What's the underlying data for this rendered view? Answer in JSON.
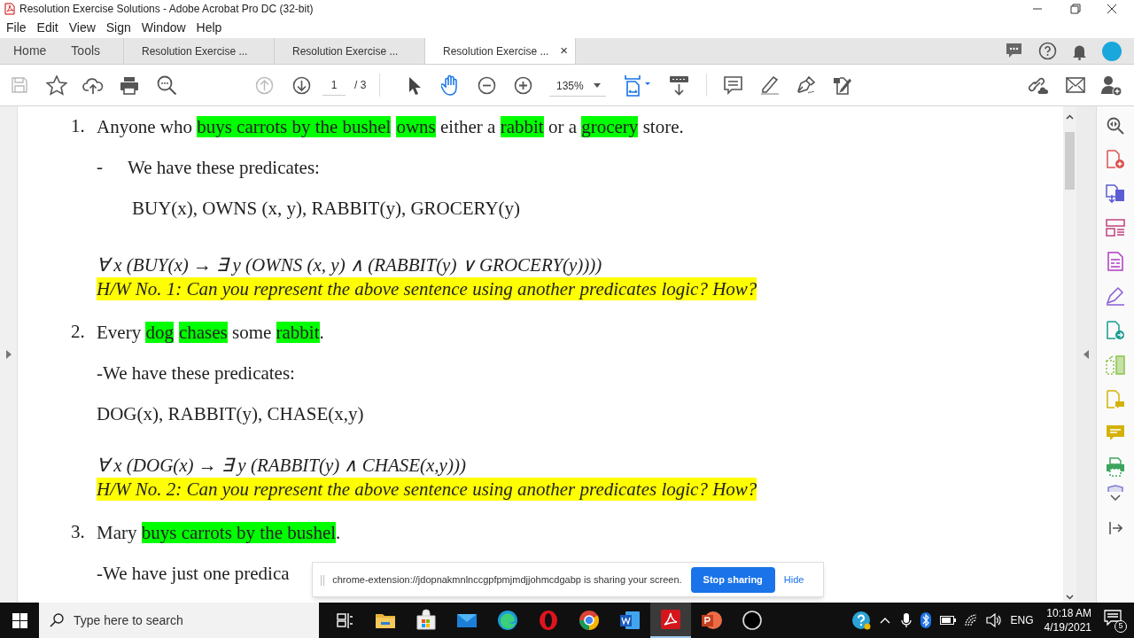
{
  "window": {
    "title": "Resolution Exercise Solutions - Adobe Acrobat Pro DC (32-bit)"
  },
  "menu": [
    "File",
    "Edit",
    "View",
    "Sign",
    "Window",
    "Help"
  ],
  "nav": [
    "Home",
    "Tools"
  ],
  "tabs": [
    {
      "label": "Resolution Exercise ...",
      "selected": false
    },
    {
      "label": "Resolution Exercise ...",
      "selected": false
    },
    {
      "label": "Resolution Exercise ...",
      "selected": true,
      "close": "×"
    }
  ],
  "toolbar": {
    "page": "1",
    "page_total": "/ 3",
    "zoom": "135%"
  },
  "document": [
    {
      "kind": "numbered",
      "number": "1.",
      "segments": [
        {
          "text": "Anyone who ",
          "highlight": false
        },
        {
          "text": "buys carrots by the bushel",
          "highlight": true,
          "space_after": true
        },
        {
          "text": "owns",
          "highlight": true
        },
        {
          "text": " either a ",
          "highlight": false
        },
        {
          "text": "rabbit",
          "highlight": true
        },
        {
          "text": " or a ",
          "highlight": false
        },
        {
          "text": "grocery",
          "highlight": true
        },
        {
          "text": " store.",
          "highlight": false
        }
      ]
    },
    {
      "kind": "dash",
      "number": "-",
      "segments": [
        {
          "text": "We have these predicates:",
          "highlight": false
        }
      ]
    },
    {
      "kind": "indented",
      "segments": [
        {
          "text": "BUY(x), OWNS (x, y), RABBIT(y), GROCERY(y)",
          "highlight": false
        }
      ]
    },
    {
      "kind": "formula",
      "segments": [
        {
          "text": "∀ x (BUY(x) → ∃ y (OWNS (x, y) ∧ (RABBIT(y) ∨ GROCERY(y))))",
          "highlight": false
        }
      ]
    },
    {
      "kind": "homework",
      "segments": [
        {
          "text": "H/W No. 1: Can you represent the above sentence using another predicates logic? How?",
          "highlight": false
        }
      ]
    },
    {
      "kind": "numbered",
      "number": "2.",
      "segments": [
        {
          "text": "Every ",
          "highlight": false
        },
        {
          "text": "dog",
          "highlight": true,
          "space_after": true
        },
        {
          "text": "chases",
          "highlight": true
        },
        {
          "text": " some ",
          "highlight": false
        },
        {
          "text": "rabbit",
          "highlight": true
        },
        {
          "text": ".",
          "highlight": false
        }
      ]
    },
    {
      "kind": "text",
      "segments": [
        {
          "text": "-We have these predicates:",
          "highlight": false
        }
      ]
    },
    {
      "kind": "text",
      "segments": [
        {
          "text": "DOG(x), RABBIT(y), CHASE(x,y)",
          "highlight": false
        }
      ]
    },
    {
      "kind": "formula",
      "segments": [
        {
          "text": "∀ x (DOG(x) → ∃ y (RABBIT(y) ∧ CHASE(x,y)))",
          "highlight": false
        }
      ]
    },
    {
      "kind": "homework",
      "segments": [
        {
          "text": "H/W No. 2: Can you represent the above sentence using another predicates logic? How?",
          "highlight": false
        }
      ]
    },
    {
      "kind": "numbered",
      "number": "3.",
      "segments": [
        {
          "text": "Mary ",
          "highlight": false
        },
        {
          "text": "buys carrots by the bushel",
          "highlight": true
        },
        {
          "text": ".",
          "highlight": false
        }
      ]
    },
    {
      "kind": "text",
      "segments": [
        {
          "text": "-We have just one predica",
          "highlight": false
        }
      ]
    }
  ],
  "share_banner": {
    "handle": "||",
    "message": "chrome-extension://jdopnakmnlnccgpfpmjmdjjohmcdgabp is sharing your screen.",
    "stop": "Stop sharing",
    "hide": "Hide"
  },
  "taskbar": {
    "search": {
      "placeholder": "Type here to search"
    },
    "apps": [
      {
        "kind": "taskview",
        "selected": false
      },
      {
        "kind": "folder",
        "selected": false
      },
      {
        "kind": "store",
        "selected": false
      },
      {
        "kind": "mail",
        "selected": false
      },
      {
        "kind": "edge",
        "selected": false
      },
      {
        "kind": "opera",
        "selected": false
      },
      {
        "kind": "chrome",
        "selected": false
      },
      {
        "kind": "word",
        "selected": false
      },
      {
        "kind": "acrobat",
        "selected": true
      },
      {
        "kind": "powerpoint",
        "selected": false
      },
      {
        "kind": "ring",
        "selected": false
      }
    ],
    "language": "ENG",
    "time": "10:18 AM",
    "date": "4/19/2021",
    "notifications": "5"
  }
}
